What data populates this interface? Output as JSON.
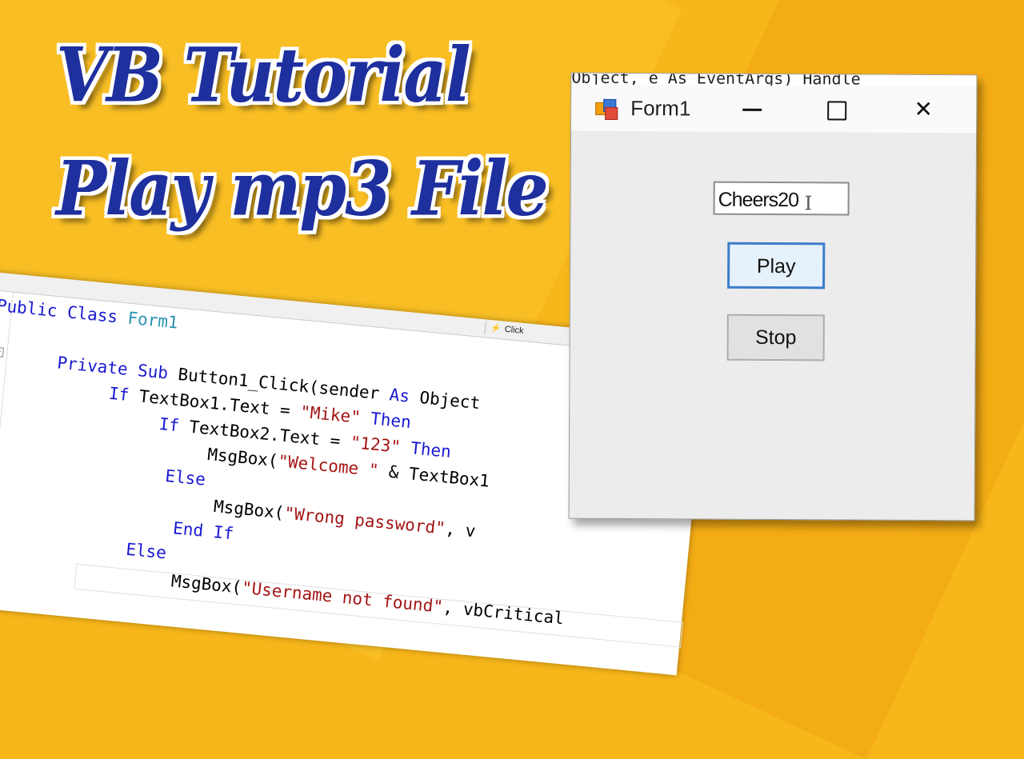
{
  "thumbnail": {
    "title_line1": "VB Tutorial",
    "title_line2": "Play mp3 File",
    "title_color": "#1e2f9e",
    "background_color": "#f7b61a"
  },
  "editor": {
    "event_dropdown": "Click",
    "collapse_glyph": "−",
    "lines": [
      {
        "parts": [
          {
            "t": "Public Class ",
            "c": "kw"
          },
          {
            "t": "Form1",
            "c": "cls"
          }
        ]
      },
      {
        "parts": [
          {
            "t": "Private Sub ",
            "c": "kw"
          },
          {
            "t": "Button1_Click(sender ",
            "c": ""
          },
          {
            "t": "As ",
            "c": "kw"
          },
          {
            "t": "Object",
            "c": ""
          }
        ]
      },
      {
        "parts": [
          {
            "t": "If ",
            "c": "kw"
          },
          {
            "t": "TextBox1.Text = ",
            "c": ""
          },
          {
            "t": "\"Mike\"",
            "c": "str"
          },
          {
            "t": " Then",
            "c": "kw"
          }
        ]
      },
      {
        "parts": [
          {
            "t": "If ",
            "c": "kw"
          },
          {
            "t": "TextBox2.Text = ",
            "c": ""
          },
          {
            "t": "\"123\"",
            "c": "str"
          },
          {
            "t": " Then",
            "c": "kw"
          }
        ]
      },
      {
        "parts": [
          {
            "t": "MsgBox(",
            "c": ""
          },
          {
            "t": "\"Welcome \"",
            "c": "str"
          },
          {
            "t": " & TextBox1",
            "c": ""
          }
        ]
      },
      {
        "parts": [
          {
            "t": "Else",
            "c": "kw"
          }
        ]
      },
      {
        "parts": [
          {
            "t": "MsgBox(",
            "c": ""
          },
          {
            "t": "\"Wrong password\"",
            "c": "str"
          },
          {
            "t": ", v",
            "c": ""
          }
        ]
      },
      {
        "parts": [
          {
            "t": "End If",
            "c": "kw"
          }
        ]
      },
      {
        "parts": [
          {
            "t": "Else",
            "c": "kw"
          }
        ]
      },
      {
        "parts": [
          {
            "t": "MsgBox(",
            "c": ""
          },
          {
            "t": "\"Username not found\"",
            "c": "str"
          },
          {
            "t": ", vbCritical",
            "c": ""
          }
        ]
      }
    ]
  },
  "window": {
    "bleed_text": "Object, e As EventArgs) Handle",
    "title": "Form1",
    "textbox_value": "Cheers20",
    "play_label": "Play",
    "stop_label": "Stop",
    "close_glyph": "✕"
  }
}
